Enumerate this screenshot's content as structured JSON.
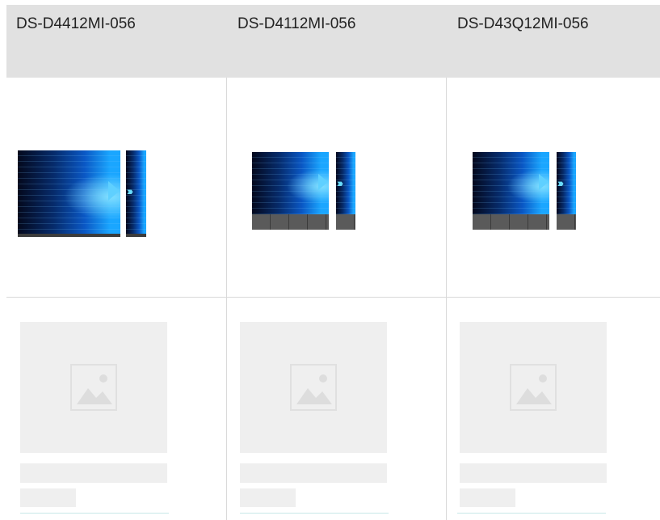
{
  "table": {
    "columns": [
      {
        "model": "DS-D4412MI-056"
      },
      {
        "model": "DS-D4112MI-056"
      },
      {
        "model": "DS-D43Q12MI-056"
      }
    ]
  },
  "colors": {
    "header_bg": "#e1e1e1",
    "divider": "#d9d9d9",
    "placeholder": "#efefef"
  },
  "icons": {
    "placeholder": "image-placeholder-icon"
  }
}
